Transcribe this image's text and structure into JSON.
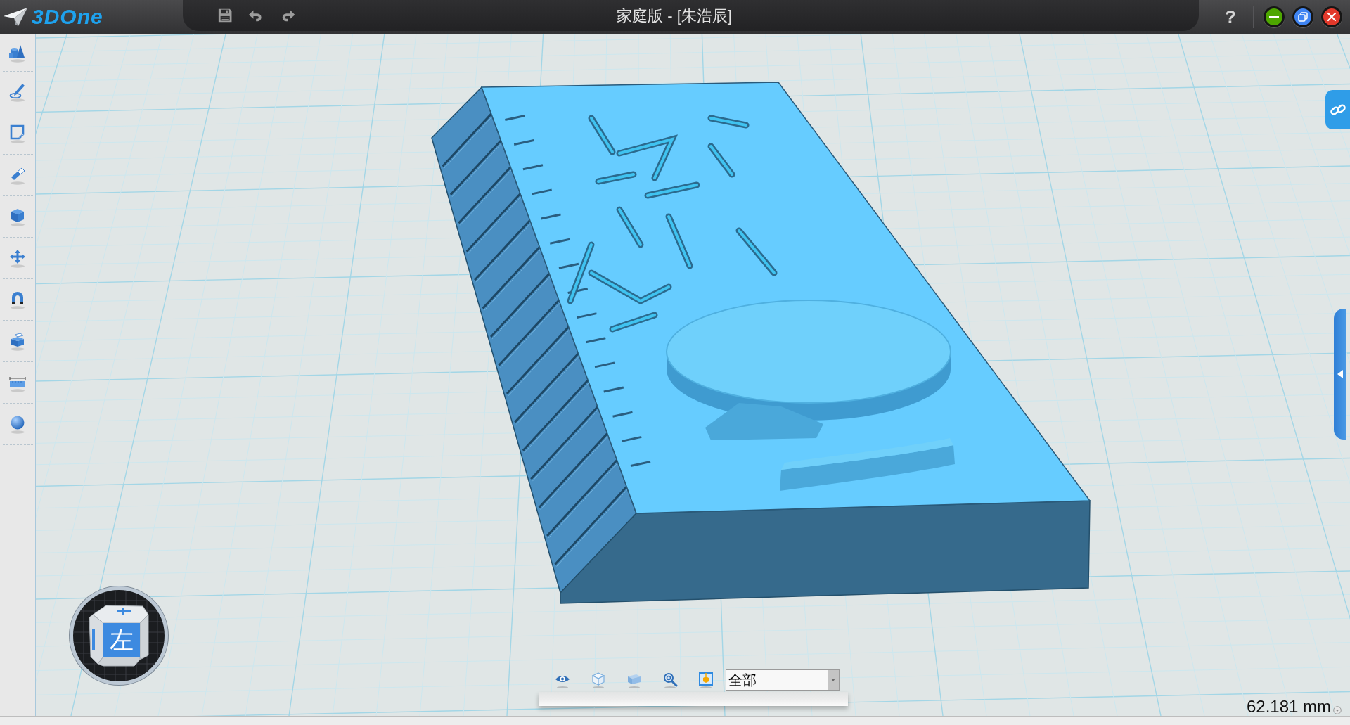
{
  "title_bar": {
    "logo_text": "3DOne",
    "title": "家庭版 - [朱浩辰]",
    "help": "?"
  },
  "view_cube": {
    "face_label": "左"
  },
  "view_toolbar": {
    "filter": {
      "value": "全部"
    }
  },
  "status": {
    "measurement": "62.181 mm"
  }
}
